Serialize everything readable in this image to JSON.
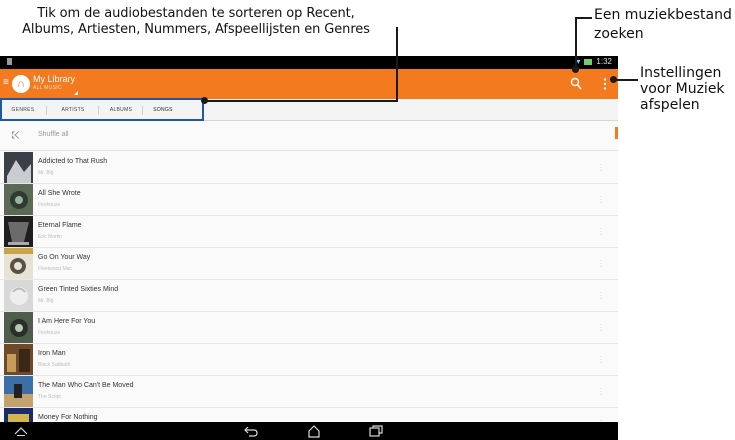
{
  "annotations": {
    "sort_line1": "Tik om de audiobestanden te sorteren op Recent,",
    "sort_line2": "Albums, Artiesten, Nummers, Afspeellijsten en Genres",
    "search_line1": "Een muziekbestand",
    "search_line2": "zoeken",
    "settings_line1": "Instellingen",
    "settings_line2": "voor Muziek",
    "settings_line3": "afspelen"
  },
  "statusbar": {
    "time": "1:32"
  },
  "actionbar": {
    "title": "My Library",
    "subtitle": "ALL MUSIC",
    "accent": "#f47a20",
    "icons": [
      "drawer-icon",
      "headphones-icon",
      "search-icon",
      "overflow-menu-icon"
    ]
  },
  "tabs": [
    {
      "label": "GENRES",
      "active": false
    },
    {
      "label": "ARTISTS",
      "active": false
    },
    {
      "label": "ALBUMS",
      "active": false
    },
    {
      "label": "SONGS",
      "active": true
    }
  ],
  "list": {
    "shuffle_label": "Shuffle all",
    "songs": [
      {
        "title": "Addicted to That Rush",
        "artist": "Mr. Big"
      },
      {
        "title": "All She Wrote",
        "artist": "Firehouse"
      },
      {
        "title": "Eternal Flame",
        "artist": "Eric Martin"
      },
      {
        "title": "Go On Your Way",
        "artist": "Fleetwood Mac"
      },
      {
        "title": "Green Tinted Sixties Mind",
        "artist": "Mr. Big"
      },
      {
        "title": "I Am Here For You",
        "artist": "Firehouse"
      },
      {
        "title": "Iron Man",
        "artist": "Black Sabbath"
      },
      {
        "title": "The Man Who Can't Be Moved",
        "artist": "The Script"
      },
      {
        "title": "Money For Nothing",
        "artist": ""
      }
    ]
  },
  "navbar": {
    "icons": [
      "collapse-icon",
      "back-icon",
      "home-icon",
      "recent-apps-icon"
    ]
  }
}
